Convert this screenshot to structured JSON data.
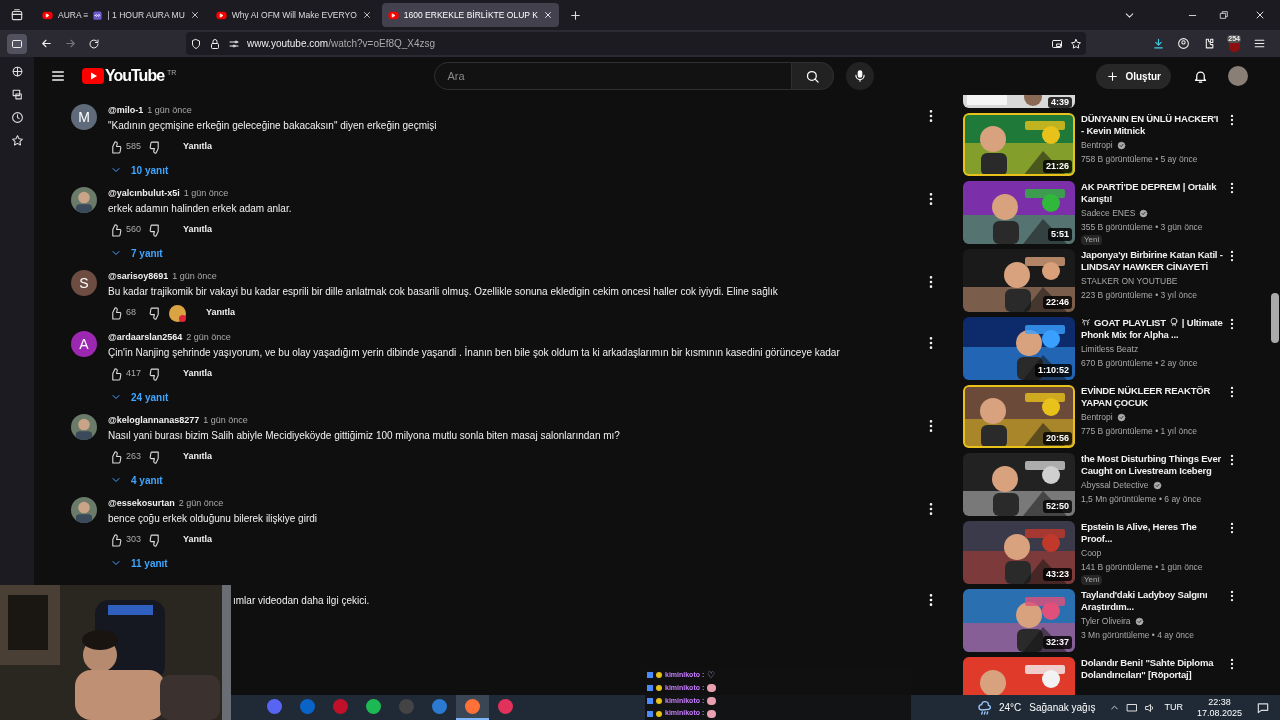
{
  "browser": {
    "tabs": [
      {
        "title": "AURA ≡",
        "title_rest": "| 1 HOUR AURA MU",
        "selected": false
      },
      {
        "title": "Why AI OFM Will Make EVERYO",
        "selected": false
      },
      {
        "title": "1600 ERKEKLE BİRLİKTE OLUP K",
        "selected": true
      }
    ],
    "url_host": "www.youtube.com",
    "url_path": "/watch?v=oEf8Q_X4zsg",
    "badge": "254"
  },
  "header": {
    "logo": "YouTube",
    "region": "TR",
    "search": {
      "placeholder": "Ara"
    },
    "create": "Oluştur"
  },
  "comments": [
    {
      "author": "@milo-1",
      "time": "1 gün önce",
      "text": "\"Kadının geçmişine erkeğin geleceğine bakacaksın\" diyen erkeğin geçmişi",
      "likes": "585",
      "reply": "Yanıtla",
      "replies": "10 yanıt",
      "avatar": {
        "kind": "letter",
        "letter": "M",
        "color": "#5f6b7a"
      },
      "creator_heart": false
    },
    {
      "author": "@yalcınbulut-x5i",
      "time": "1 gün önce",
      "text": "erkek adamın halinden erkek adam anlar.",
      "likes": "560",
      "reply": "Yanıtla",
      "replies": "7 yanıt",
      "creator_heart": false
    },
    {
      "author": "@sarisoy8691",
      "time": "1 gün önce",
      "text": "Bu kadar trajikomik bir vakayi bu kadar esprili bir dille anlatmak cok basarili olmuş. Ozellikle sonuna ekledigin cekim oncesi haller cok iyiydi. Eline sağlık",
      "likes": "68",
      "reply": "Yanıtla",
      "avatar": {
        "kind": "letter",
        "letter": "S",
        "color": "#6d4c41"
      },
      "creator_heart": true
    },
    {
      "author": "@ardaarslan2564",
      "time": "2 gün önce",
      "text": "Çin'in Nanjing şehrinde yaşıyorum, ve bu olay yaşadığım yerin dibinde yaşandi . İnanın ben bile şok oldum ta ki arkadaşlarımın bir kısmının kasedini görünceye kadar",
      "likes": "417",
      "reply": "Yanıtla",
      "replies": "24 yanıt",
      "avatar": {
        "kind": "letter",
        "letter": "A",
        "color": "#9c27b0"
      },
      "creator_heart": false
    },
    {
      "author": "@keloglannanas8277",
      "time": "1 gün önce",
      "text": "Nasıl yani burası bizim Salih abiyle Mecidiyeköyde gittiğimiz 100 milyona mutlu sonla biten masaj salonlarından mı?",
      "likes": "263",
      "reply": "Yanıtla",
      "replies": "4 yanıt",
      "creator_heart": false
    },
    {
      "author": "@essekosurtan",
      "time": "2 gün önce",
      "text": "bence çoğu erkek olduğunu bilerek ilişkiye girdi",
      "likes": "303",
      "reply": "Yanıtla",
      "replies": "11 yanıt",
      "creator_heart": false
    }
  ],
  "partial_comment": {
    "text": "ımlar videodan daha ilgi çekici."
  },
  "top_cut_video": {
    "duration": "4:39"
  },
  "videos": [
    {
      "title": "DÜNYANIN EN ÜNLÜ HACKER'I - Kevin Mitnick",
      "channel": "Bentropi",
      "verified": true,
      "meta": "758 B görüntüleme • 5 ay önce",
      "duration": "21:26"
    },
    {
      "title": "AK PARTİ'DE DEPREM | Ortalık Karıştı!",
      "channel": "Sadece ENES",
      "verified": true,
      "meta": "355 B görüntüleme • 3 gün önce",
      "duration": "5:51",
      "badge": "Yeni"
    },
    {
      "title": "Japonya'yı Birbirine Katan Katil - LINDSAY HAWKER CİNAYETİ",
      "channel": "STALKER ON YOUTUBE",
      "verified": false,
      "meta": "223 B görüntüleme • 3 yıl önce",
      "duration": "22:46"
    },
    {
      "title": "GOAT PLAYLIST",
      "title_rest": "| Ultimate Phonk Mix for Alpha ...",
      "kind": "emoji_title",
      "channel": "Limitless Beatz",
      "verified": false,
      "meta": "670 B görüntüleme • 2 ay önce",
      "duration": "1:10:52"
    },
    {
      "title": "EVİNDE NÜKLEER REAKTÖR YAPAN ÇOCUK",
      "channel": "Bentropi",
      "verified": true,
      "meta": "775 B görüntüleme • 1 yıl önce",
      "duration": "20:56"
    },
    {
      "title": "the Most Disturbing Things Ever Caught on Livestream Iceberg",
      "channel": "Abyssal Detective",
      "verified": true,
      "meta": "1,5 Mn görüntüleme • 6 ay önce",
      "duration": "52:50"
    },
    {
      "title": "Epstein Is Alive, Heres The Proof...",
      "channel": "Coop",
      "verified": false,
      "meta": "141 B görüntüleme • 1 gün önce",
      "duration": "43:23",
      "badge": "Yeni"
    },
    {
      "title": "Tayland'daki Ladyboy Salgını Araştırdım...",
      "channel": "Tyler Oliveira",
      "verified": true,
      "meta": "3 Mn görüntüleme • 4 ay önce",
      "duration": "32:37"
    },
    {
      "title": "Dolandır Beni! \"Sahte Diploma Dolandırıcıları\" [Röportaj]"
    }
  ],
  "chat": [
    {
      "user": "kiminikoto :",
      "emote": "♡"
    },
    {
      "user": "kiminikoto :"
    },
    {
      "user": "kiminikoto :"
    },
    {
      "user": "kiminikoto :"
    }
  ],
  "taskbar": {
    "apps": [
      {
        "color": "#5865f2",
        "selected": false
      },
      {
        "color": "#0a64c8",
        "selected": false
      },
      {
        "color": "#c0102a",
        "selected": false
      },
      {
        "color": "#1db954",
        "selected": false
      },
      {
        "color": "#444444",
        "selected": false
      },
      {
        "color": "#2b79d0",
        "selected": false
      },
      {
        "color": "#ff7139",
        "selected": true
      },
      {
        "color": "#e0325a",
        "selected": false
      }
    ],
    "weather": "24°C",
    "weather_text": "Sağanak yağış",
    "lang": "TUR",
    "time": "22:38",
    "date": "17.08.2025"
  }
}
